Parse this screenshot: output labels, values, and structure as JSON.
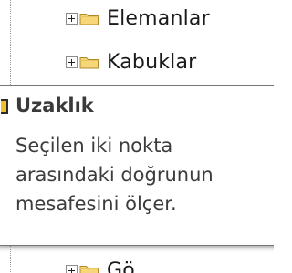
{
  "tree": {
    "nodes": [
      {
        "label": "Elemanlar",
        "icon": "folder-icon",
        "expander": "plus"
      },
      {
        "label": "Kabuklar",
        "icon": "folder-icon",
        "expander": "plus"
      },
      {
        "label": "Gö",
        "icon": "folder-icon",
        "expander": "plus"
      }
    ]
  },
  "tooltip": {
    "title": "Uzaklık",
    "icon": "ruler-icon",
    "body_lines": [
      "Seçilen iki nokta",
      "arasındaki doğrunun",
      "mesafesini ölçer."
    ]
  },
  "colors": {
    "folder_fill": "#f5d77a",
    "folder_stroke": "#b08a2a",
    "tooltip_border": "#767676",
    "icon_accent": "#f0c02a"
  }
}
